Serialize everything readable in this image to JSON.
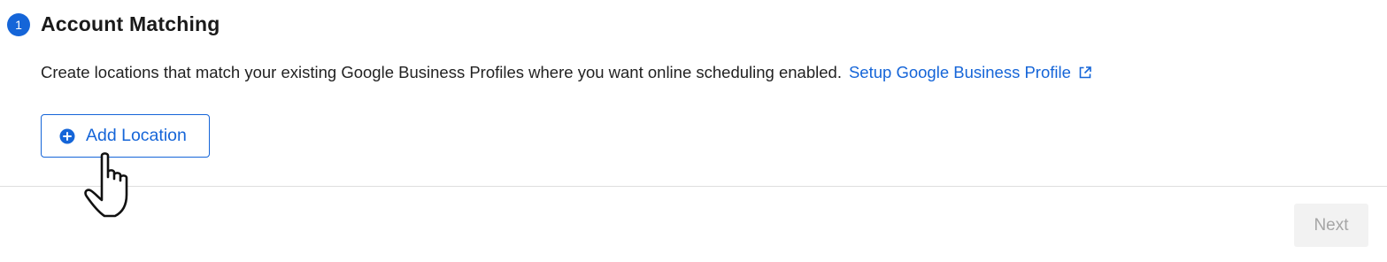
{
  "step": {
    "number": "1",
    "title": "Account Matching"
  },
  "description": {
    "text": "Create locations that match your existing Google Business Profiles where you want online scheduling enabled.",
    "link_label": "Setup Google Business Profile",
    "link_icon": "external-link-icon"
  },
  "add_location": {
    "label": "Add Location",
    "icon": "plus-circle-icon"
  },
  "footer": {
    "next_label": "Next",
    "next_disabled": true
  },
  "colors": {
    "accent": "#1565d8",
    "disabled_bg": "#f2f2f2",
    "disabled_text": "#a6a6a6",
    "divider": "#dedede"
  },
  "cursor": "hand-pointer-icon"
}
